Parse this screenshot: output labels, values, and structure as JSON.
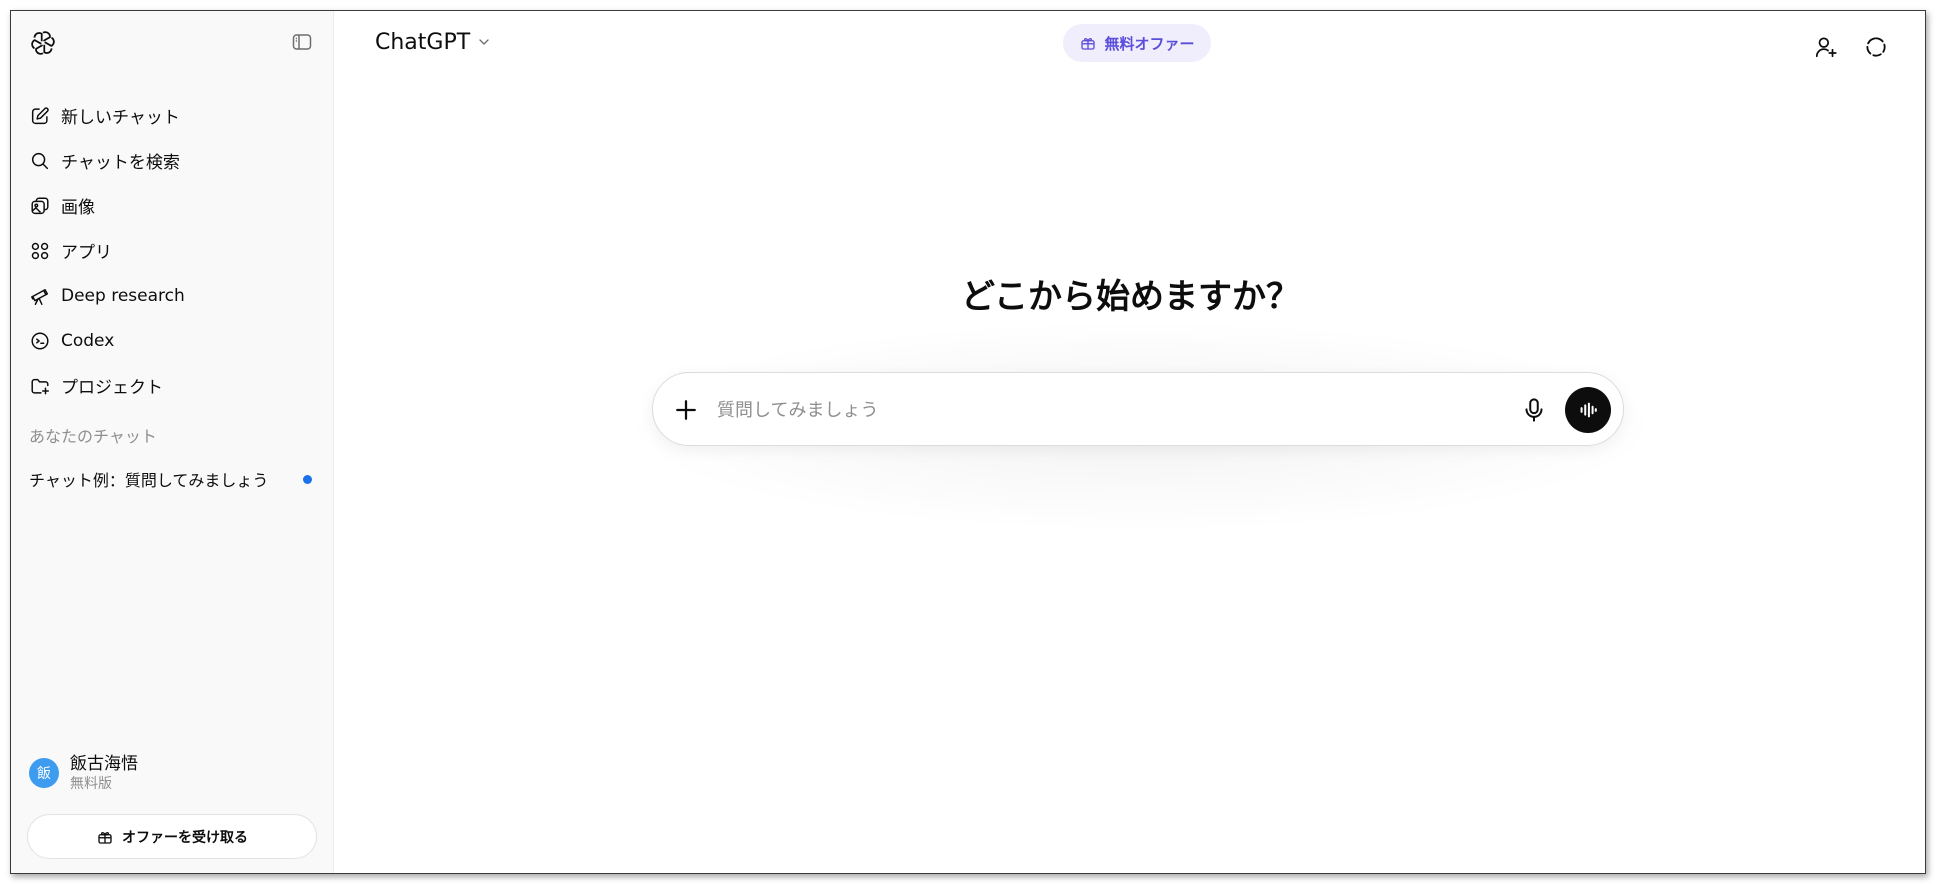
{
  "sidebar": {
    "nav": [
      {
        "label": "新しいチャット",
        "icon": "edit-icon"
      },
      {
        "label": "チャットを検索",
        "icon": "search-icon"
      },
      {
        "label": "画像",
        "icon": "images-icon"
      },
      {
        "label": "アプリ",
        "icon": "apps-grid-icon"
      },
      {
        "label": "Deep research",
        "icon": "telescope-icon"
      },
      {
        "label": "Codex",
        "icon": "codex-icon"
      },
      {
        "label": "プロジェクト",
        "icon": "folder-plus-icon"
      }
    ],
    "section_label": "あなたのチャット",
    "chats": [
      {
        "title": "チャット例：質問してみましょう",
        "unread": true
      }
    ],
    "user": {
      "avatar": "飯",
      "name": "飯古海悟",
      "plan": "無料版"
    },
    "offer_button": "オファーを受け取る"
  },
  "header": {
    "model": "ChatGPT",
    "free_offer": "無料オファー"
  },
  "main": {
    "headline": "どこから始めますか？",
    "composer": {
      "placeholder": "質問してみましょう",
      "value": ""
    }
  },
  "colors": {
    "accent": "#5b4fd9",
    "unread_dot": "#1a73e8",
    "avatar_bg": "#3d9cf0",
    "sidebar_bg": "#f9f9f9"
  }
}
